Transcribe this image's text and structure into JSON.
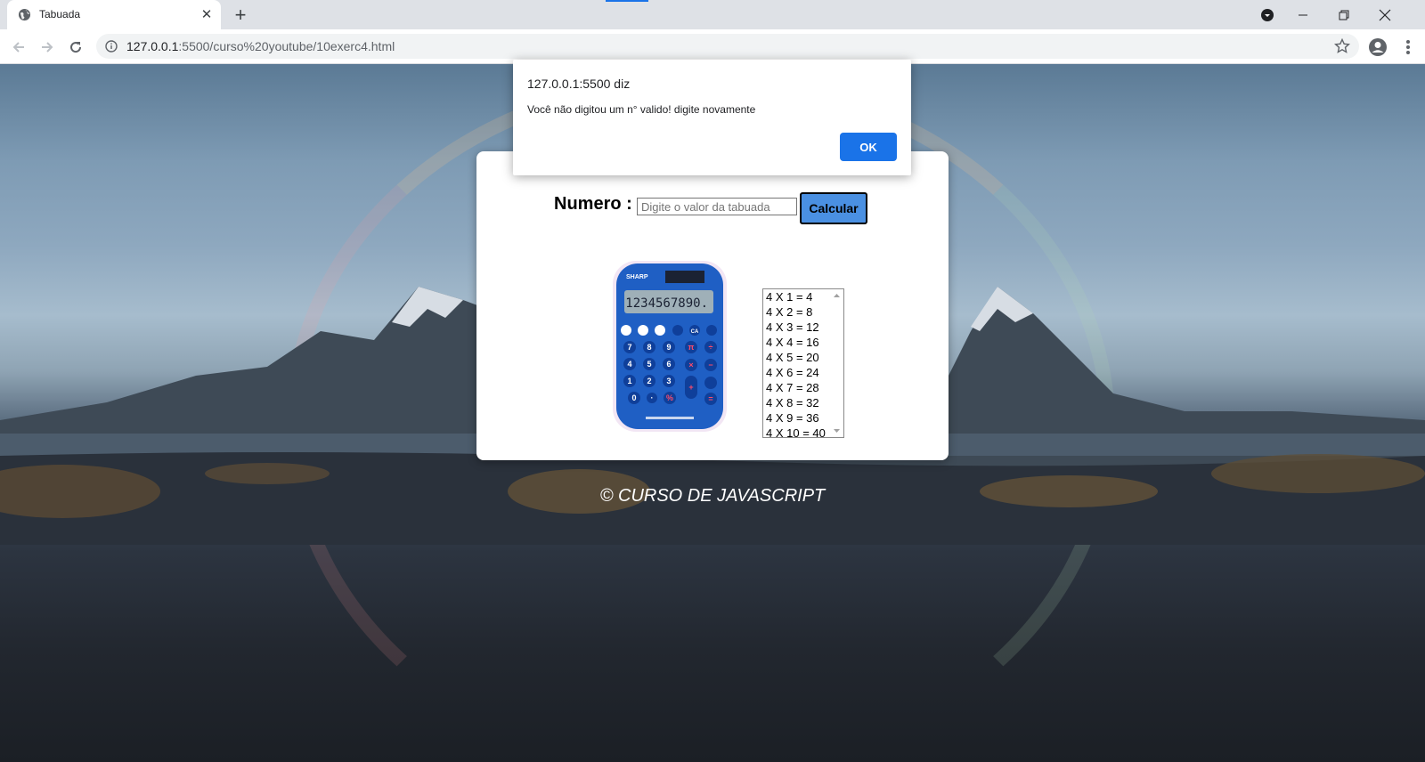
{
  "browser": {
    "tab_title": "Tabuada",
    "url_host": "127.0.0.1",
    "url_rest": ":5500/curso%20youtube/10exerc4.html"
  },
  "form": {
    "label": "Numero :",
    "input_placeholder": "Digite o valor da tabuada",
    "input_value": "",
    "button_label": "Calcular"
  },
  "tabuada": {
    "rows": [
      "4 X 1 = 4",
      "4 X 2 = 8",
      "4 X 3 = 12",
      "4 X 4 = 16",
      "4 X 5 = 20",
      "4 X 6 = 24",
      "4 X 7 = 28",
      "4 X 8 = 32",
      "4 X 9 = 36",
      "4 X 10 = 40"
    ]
  },
  "calculator": {
    "brand": "SHARP",
    "display": "1234567890."
  },
  "footer": {
    "text": "© CURSO DE JAVASCRIPT"
  },
  "dialog": {
    "title": "127.0.0.1:5500 diz",
    "message": "Você não digitou um n° valido! digite novamente",
    "ok_label": "OK"
  },
  "colors": {
    "button_accent": "#4a90e2",
    "dialog_ok": "#1a73e8"
  }
}
